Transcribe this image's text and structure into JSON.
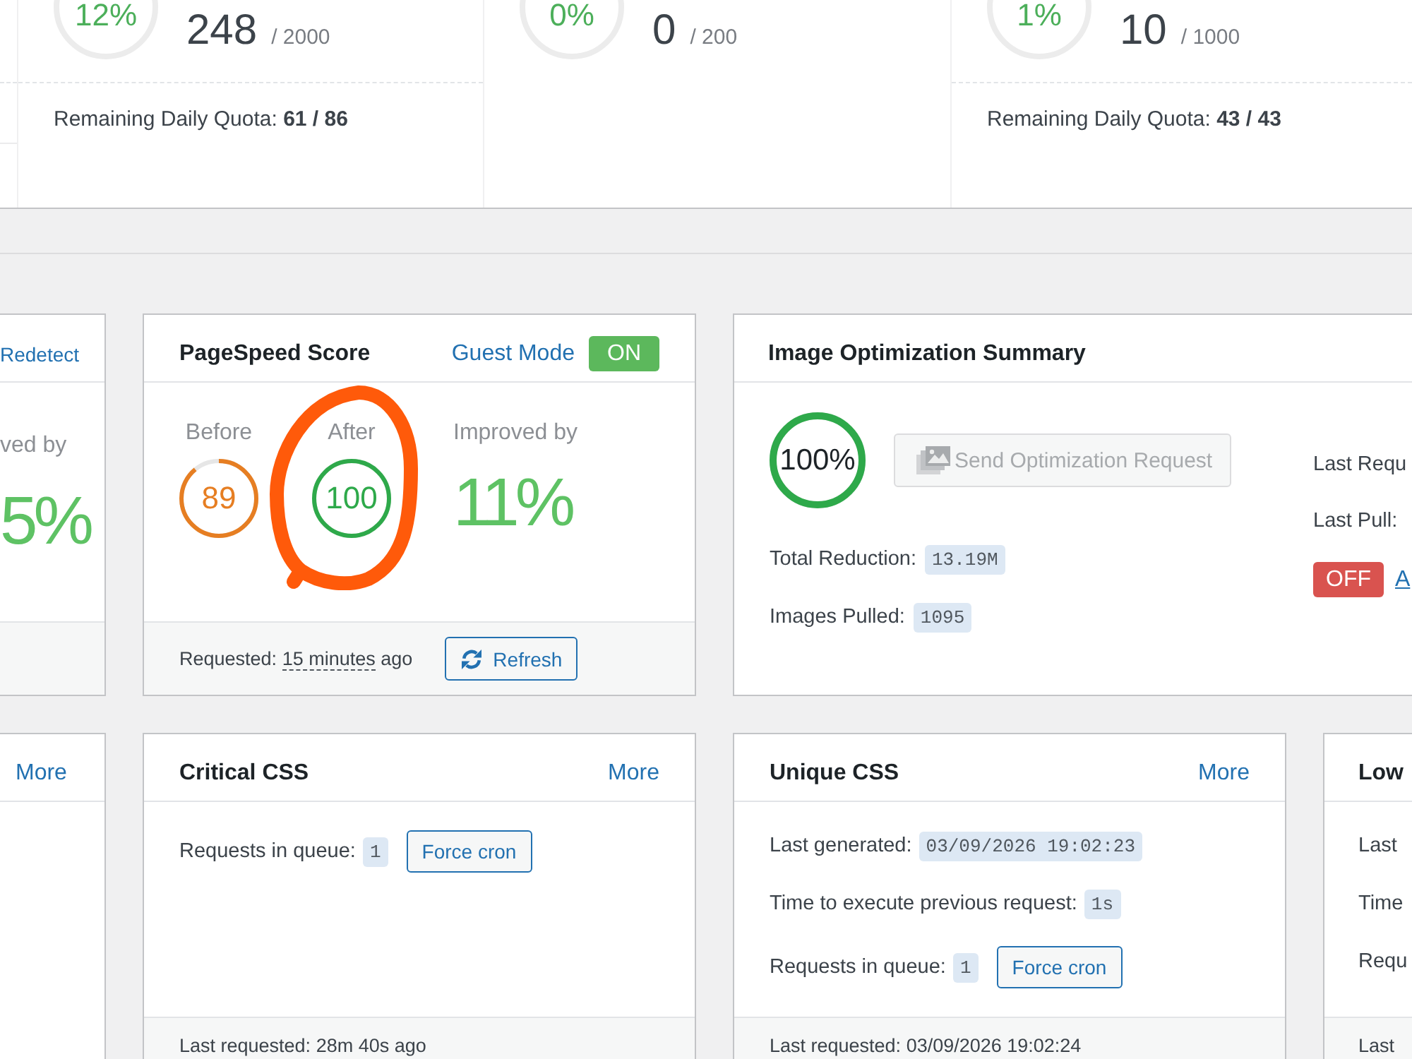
{
  "quota_panel": {
    "columns": [
      {
        "percent": "12%",
        "used": "248",
        "total": "/ 2000",
        "remaining": "Remaining Daily Quota: **61 / 86**"
      },
      {
        "percent": "0%",
        "used": "0",
        "total": "/ 200"
      },
      {
        "percent": "1%",
        "used": "10",
        "total": "/ 1000",
        "remaining": "Remaining Daily Quota: **43 / 43**"
      }
    ]
  },
  "cards_row_1": [
    {
      "kind": "cut_score",
      "header_link": "Redetect",
      "improved_label": "ved by",
      "improved_value": "5%"
    },
    {
      "kind": "pagespeed",
      "title": "PageSpeed Score",
      "guest_mode": {
        "label": "Guest Mode",
        "badge": "ON",
        "on": true
      },
      "scores": [
        {
          "label": "Before",
          "value": "89",
          "level": 0.89,
          "color": "#e67e22"
        },
        {
          "label": "After",
          "value": "100",
          "level": 1,
          "color": "#2ea94a"
        }
      ],
      "improved_label": "Improved by",
      "improved_value": "11%",
      "requested": {
        "label": "Requested:",
        "time": "15 minutes",
        "suffix": "ago"
      },
      "refresh_button": "Refresh"
    },
    {
      "kind": "image_summary",
      "title": "Image Optimization Summary",
      "progress": {
        "text": "100%",
        "level": 1
      },
      "send_button": {
        "label": "Send Optimization Request",
        "disabled": true
      },
      "stats": [
        {
          "label": "Total Reduction:",
          "value": "13.19M"
        },
        {
          "label": "Images Pulled:",
          "value": "1095"
        }
      ],
      "side": {
        "last_request": "Last Requ",
        "last_pull": "Last Pull:",
        "auto": {
          "badge": "OFF",
          "on": false
        },
        "link": "A"
      }
    }
  ],
  "cards_row_2": [
    {
      "kind": "cut_links",
      "more_link": "More"
    },
    {
      "kind": "queue",
      "title": "Critical CSS",
      "more_link": "More",
      "rows": [
        {
          "label": "Requests in queue:",
          "value": "1",
          "button": "Force cron"
        }
      ],
      "footer": "Last requested: 28m 40s ago"
    },
    {
      "kind": "queue",
      "title": "Unique CSS",
      "more_link": "More",
      "rows": [
        {
          "label": "Last generated:",
          "value": "03/09/2026 19:02:23"
        },
        {
          "label": "Time to execute previous request:",
          "value": "1s"
        },
        {
          "label": "Requests in queue:",
          "value": "1",
          "button": "Force cron"
        }
      ],
      "footer": "Last requested: 03/09/2026 19:02:24"
    },
    {
      "kind": "queue",
      "title": "Low",
      "rows": [
        {
          "label": "Last"
        },
        {
          "label": "Time"
        },
        {
          "label": "Requ"
        }
      ],
      "footer": "Last"
    }
  ]
}
